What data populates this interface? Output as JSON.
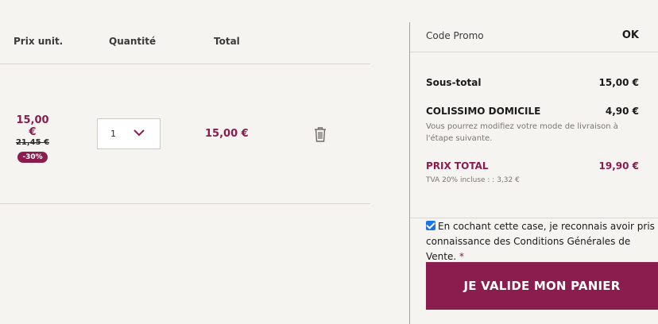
{
  "cart": {
    "columns": {
      "unit_price": "Prix unit.",
      "quantity": "Quantité",
      "total": "Total"
    },
    "item": {
      "price_now": "15,00 €",
      "price_old": "21,45 €",
      "discount": "-30%",
      "quantity": "1",
      "line_total": "15,00 €",
      "icons": {
        "quantity_dropdown": "chevron-down-icon",
        "remove": "trash-icon"
      }
    }
  },
  "summary": {
    "promo_label": "Code Promo",
    "promo_button": "OK",
    "subtotal_label": "Sous-total",
    "subtotal_value": "15,00 €",
    "shipping_label": "COLISSIMO DOMICILE",
    "shipping_value": "4,90 €",
    "shipping_note": "Vous pourrez modifiez votre mode de livraison à l'étape suivante.",
    "total_label": "PRIX TOTAL",
    "total_value": "19,90 €",
    "vat_note": "TVA 20% incluse : : 3,32 €",
    "cgv_text": "En cochant cette case, je reconnais avoir pris connaissance des Conditions Générales de Vente.",
    "cgv_required_mark": "*",
    "cgv_checked": true,
    "validate_button": "JE VALIDE MON PANIER"
  },
  "colors": {
    "accent": "#8a1c4e",
    "background": "#f6f4f1",
    "checkbox": "#1a73e8"
  }
}
